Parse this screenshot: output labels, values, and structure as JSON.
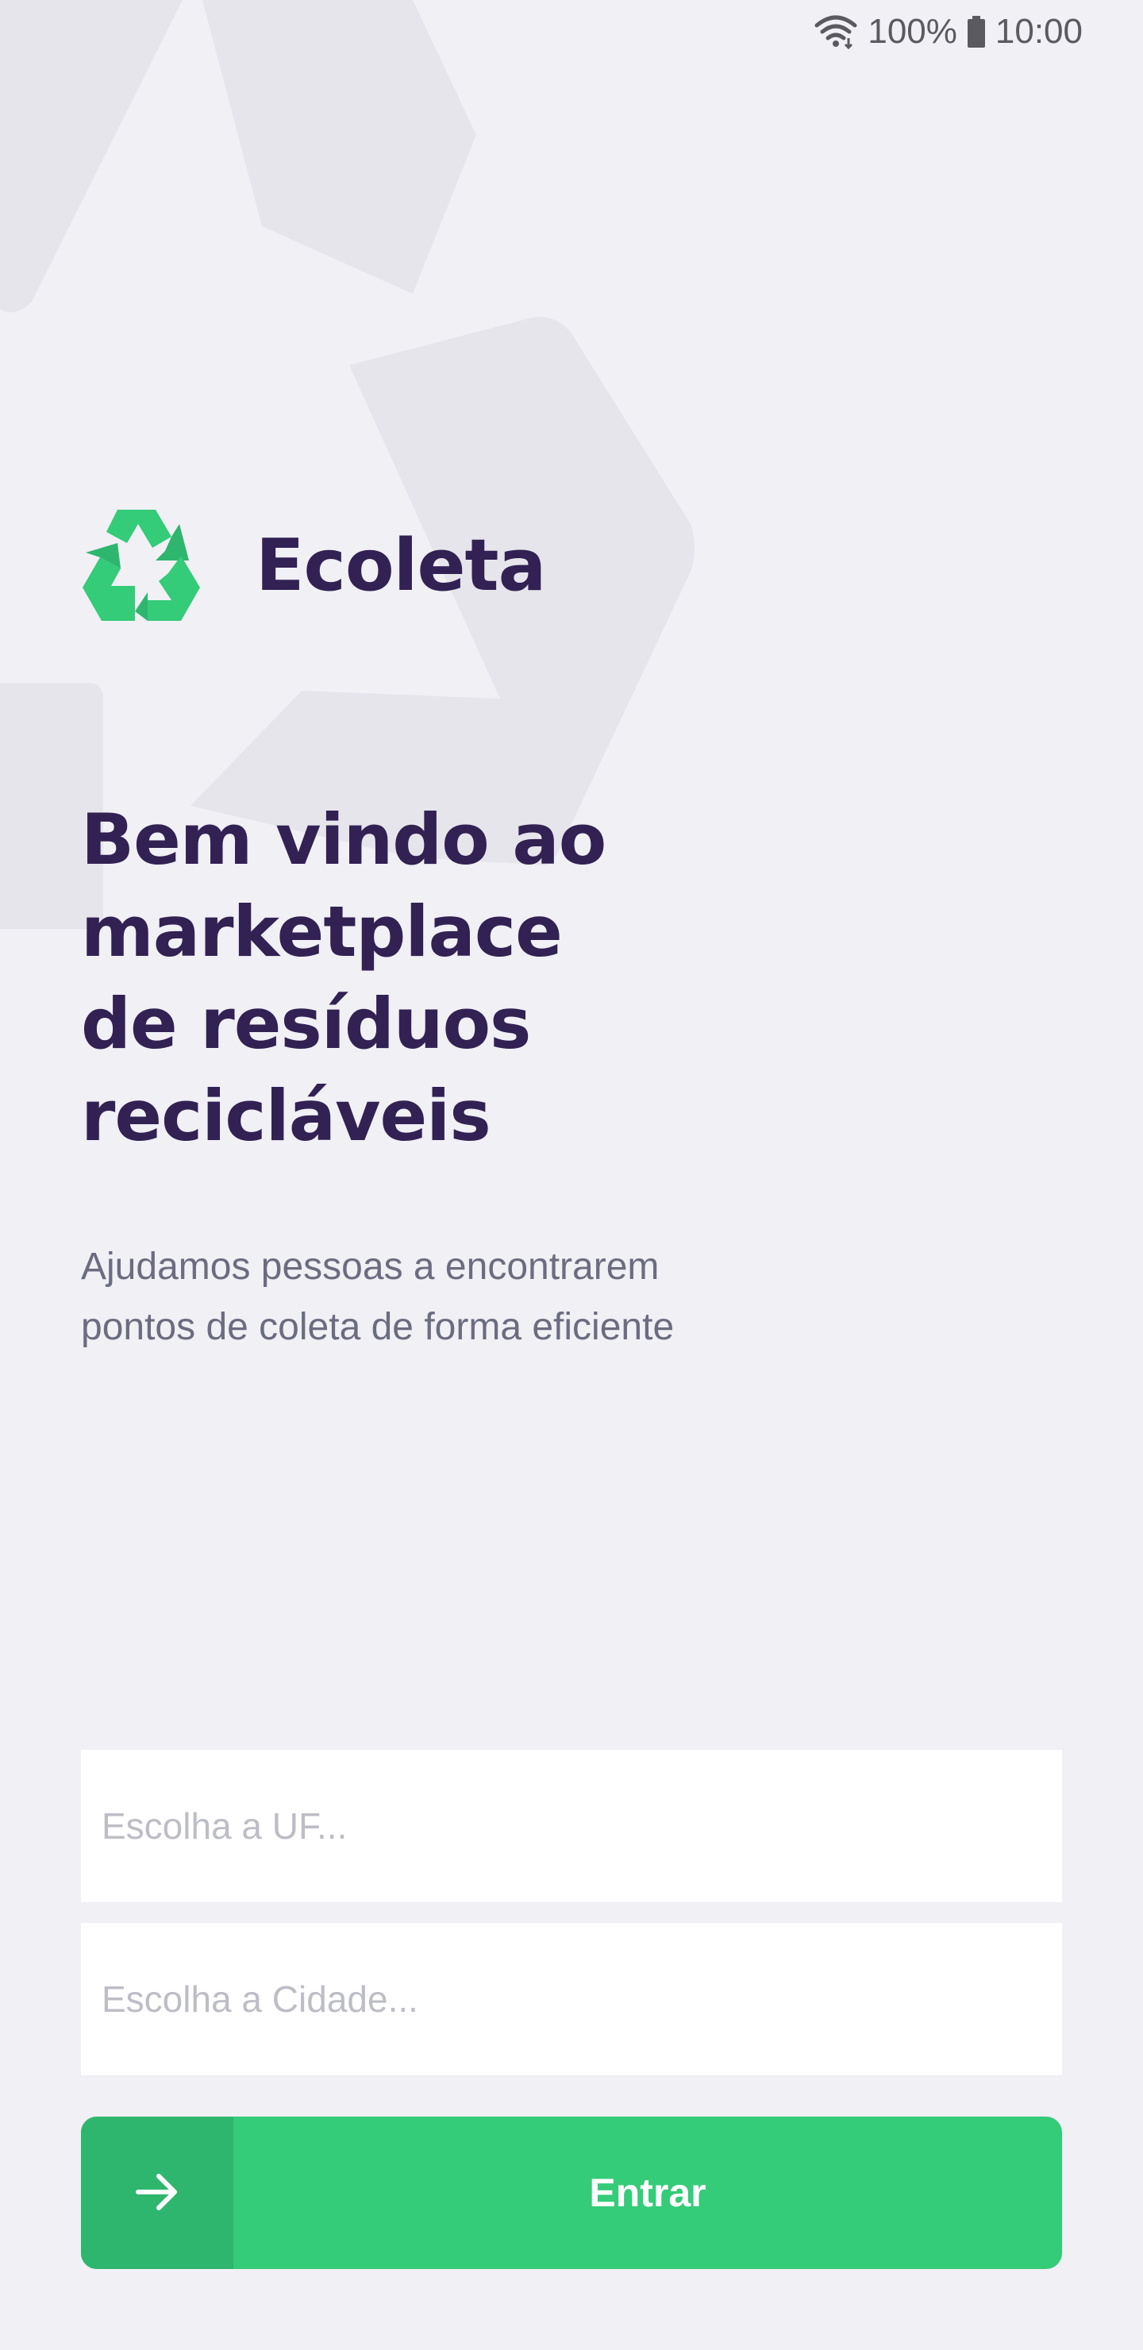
{
  "status_bar": {
    "battery_text": "100%",
    "time": "10:00",
    "icons": [
      "wifi-icon",
      "battery-icon"
    ]
  },
  "logo": {
    "icon": "recycle-icon",
    "text": "Ecoleta"
  },
  "hero": {
    "title_lines": [
      "Bem vindo ao",
      "marketplace",
      "de resíduos",
      "recicláveis"
    ],
    "description_lines": [
      "Ajudamos pessoas a encontrarem",
      "pontos de coleta de forma eficiente"
    ]
  },
  "form": {
    "uf_placeholder": "Escolha a UF...",
    "city_placeholder": "Escolha a Cidade...",
    "enter_label": "Entrar",
    "enter_icon": "arrow-right-icon"
  },
  "colors": {
    "background": "#F0F0F5",
    "title": "#322153",
    "text": "#6C6C80",
    "primary": "#34CB79",
    "primary_dark": "#2EB66E"
  }
}
